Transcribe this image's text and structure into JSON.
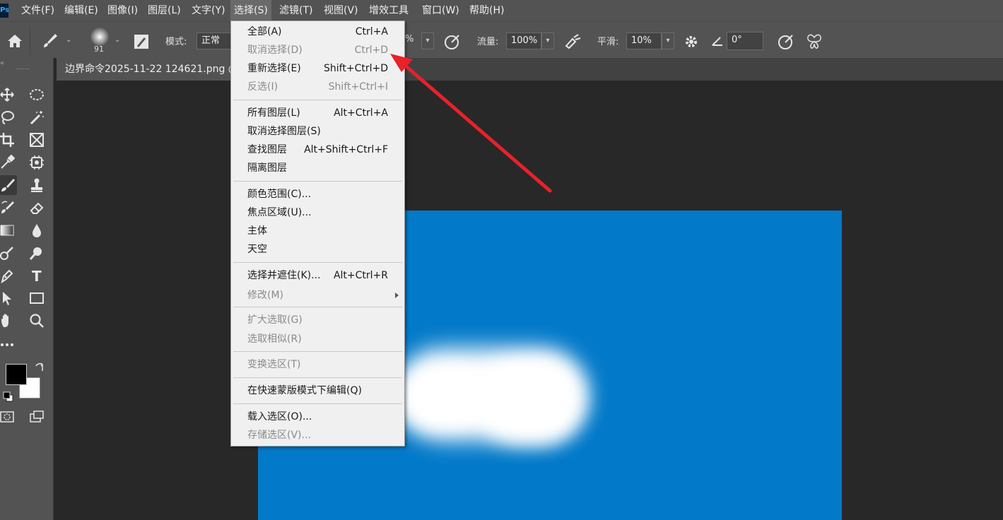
{
  "app": {
    "logo": "Ps"
  },
  "menubar": {
    "items": [
      "文件(F)",
      "编辑(E)",
      "图像(I)",
      "图层(L)",
      "文字(Y)",
      "选择(S)",
      "滤镜(T)",
      "视图(V)",
      "增效工具",
      "窗口(W)",
      "帮助(H)"
    ],
    "active_index": 5
  },
  "options": {
    "brush_size": "91",
    "mode_label": "模式:",
    "mode_value": "正常",
    "opacity_suffix": "%",
    "flow_label": "流量:",
    "flow_value": "100%",
    "smooth_label": "平滑:",
    "smooth_value": "10%",
    "angle_value": "0°"
  },
  "document": {
    "tab_title": "边界命令2025-11-22 124621.png @"
  },
  "select_menu": {
    "groups": [
      [
        {
          "label": "全部(A)",
          "shortcut": "Ctrl+A",
          "disabled": false
        },
        {
          "label": "取消选择(D)",
          "shortcut": "Ctrl+D",
          "disabled": true
        },
        {
          "label": "重新选择(E)",
          "shortcut": "Shift+Ctrl+D",
          "disabled": false
        },
        {
          "label": "反选(I)",
          "shortcut": "Shift+Ctrl+I",
          "disabled": true
        }
      ],
      [
        {
          "label": "所有图层(L)",
          "shortcut": "Alt+Ctrl+A",
          "disabled": false
        },
        {
          "label": "取消选择图层(S)",
          "shortcut": "",
          "disabled": false
        },
        {
          "label": "查找图层",
          "shortcut": "Alt+Shift+Ctrl+F",
          "disabled": false
        },
        {
          "label": "隔离图层",
          "shortcut": "",
          "disabled": false
        }
      ],
      [
        {
          "label": "颜色范围(C)...",
          "shortcut": "",
          "disabled": false
        },
        {
          "label": "焦点区域(U)...",
          "shortcut": "",
          "disabled": false
        },
        {
          "label": "主体",
          "shortcut": "",
          "disabled": false
        },
        {
          "label": "天空",
          "shortcut": "",
          "disabled": false
        }
      ],
      [
        {
          "label": "选择并遮住(K)...",
          "shortcut": "Alt+Ctrl+R",
          "disabled": false
        },
        {
          "label": "修改(M)",
          "shortcut": "",
          "disabled": true,
          "submenu": true
        }
      ],
      [
        {
          "label": "扩大选取(G)",
          "shortcut": "",
          "disabled": true
        },
        {
          "label": "选取相似(R)",
          "shortcut": "",
          "disabled": true
        }
      ],
      [
        {
          "label": "变换选区(T)",
          "shortcut": "",
          "disabled": true
        }
      ],
      [
        {
          "label": "在快速蒙版模式下编辑(Q)",
          "shortcut": "",
          "disabled": false
        }
      ],
      [
        {
          "label": "载入选区(O)...",
          "shortcut": "",
          "disabled": false
        },
        {
          "label": "存储选区(V)...",
          "shortcut": "",
          "disabled": true
        }
      ]
    ]
  },
  "colors": {
    "canvas_blue": "#0279c9",
    "annotation_red": "#e8212b"
  },
  "toolbar": {
    "tools": [
      "move-tool-icon",
      "elliptical-marquee-icon",
      "lasso-icon",
      "magic-wand-icon",
      "crop-icon",
      "frame-icon",
      "eyedropper-icon",
      "healing-brush-icon",
      "brush-icon",
      "clone-stamp-icon",
      "history-brush-icon",
      "eraser-icon",
      "gradient-icon",
      "blur-icon",
      "dodge-icon",
      "zoom-lens-icon",
      "pen-icon",
      "type-icon",
      "path-select-icon",
      "rectangle-icon",
      "hand-icon",
      "zoom-icon"
    ],
    "type_glyph": "T"
  }
}
